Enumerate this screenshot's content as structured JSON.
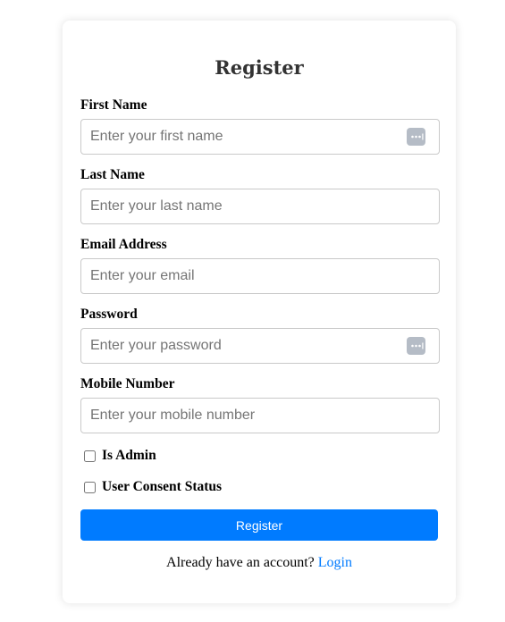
{
  "form": {
    "title": "Register",
    "fields": [
      {
        "label": "First Name",
        "placeholder": "Enter your first name",
        "value": ""
      },
      {
        "label": "Last Name",
        "placeholder": "Enter your last name",
        "value": ""
      },
      {
        "label": "Email Address",
        "placeholder": "Enter your email",
        "value": ""
      },
      {
        "label": "Password",
        "placeholder": "Enter your password",
        "value": ""
      },
      {
        "label": "Mobile Number",
        "placeholder": "Enter your mobile number",
        "value": ""
      }
    ],
    "checkboxes": [
      {
        "label": "Is Admin",
        "checked": false
      },
      {
        "label": "User Consent Status",
        "checked": false
      }
    ],
    "submit_label": "Register",
    "footer_text": "Already have an account?",
    "login_link": "Login"
  },
  "colors": {
    "primary": "#007bff",
    "title": "#333333",
    "input_border": "#c9c9c9",
    "autofill_icon": "#b5bcc6"
  },
  "icons": {
    "autofill": "password-manager-icon"
  }
}
